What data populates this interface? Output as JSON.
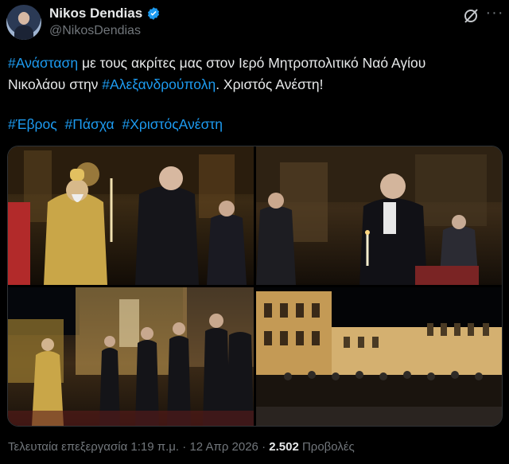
{
  "author": {
    "name": "Nikos Dendias",
    "handle": "@NikosDendias"
  },
  "tweet": {
    "line1_tag": "#Ανάσταση",
    "line1_rest": " με τους ακρίτες μας στον Ιερό Μητροπολιτικό Ναό Αγίου",
    "line2_start": "Νικολάου στην ",
    "line2_tag": "#Αλεξανδρούπολη",
    "line2_rest": ". Χριστός Ανέστη!",
    "hashtags": [
      "#Έβρος",
      "#Πάσχα",
      "#ΧριστόςΑνέστη"
    ]
  },
  "footer": {
    "edited_label": "Τελευταία επεξεργασία 1:19 π.μ.",
    "separator": "·",
    "date": "12 Απρ 2026",
    "views_count": "2.502",
    "views_label": "Προβολές"
  },
  "icons": {
    "verified": "verified-badge-icon",
    "grok": "grok-icon",
    "more": "more-icon"
  },
  "colors": {
    "background": "#000000",
    "text": "#e7e9ea",
    "secondary": "#71767b",
    "link": "#1d9bf0"
  }
}
